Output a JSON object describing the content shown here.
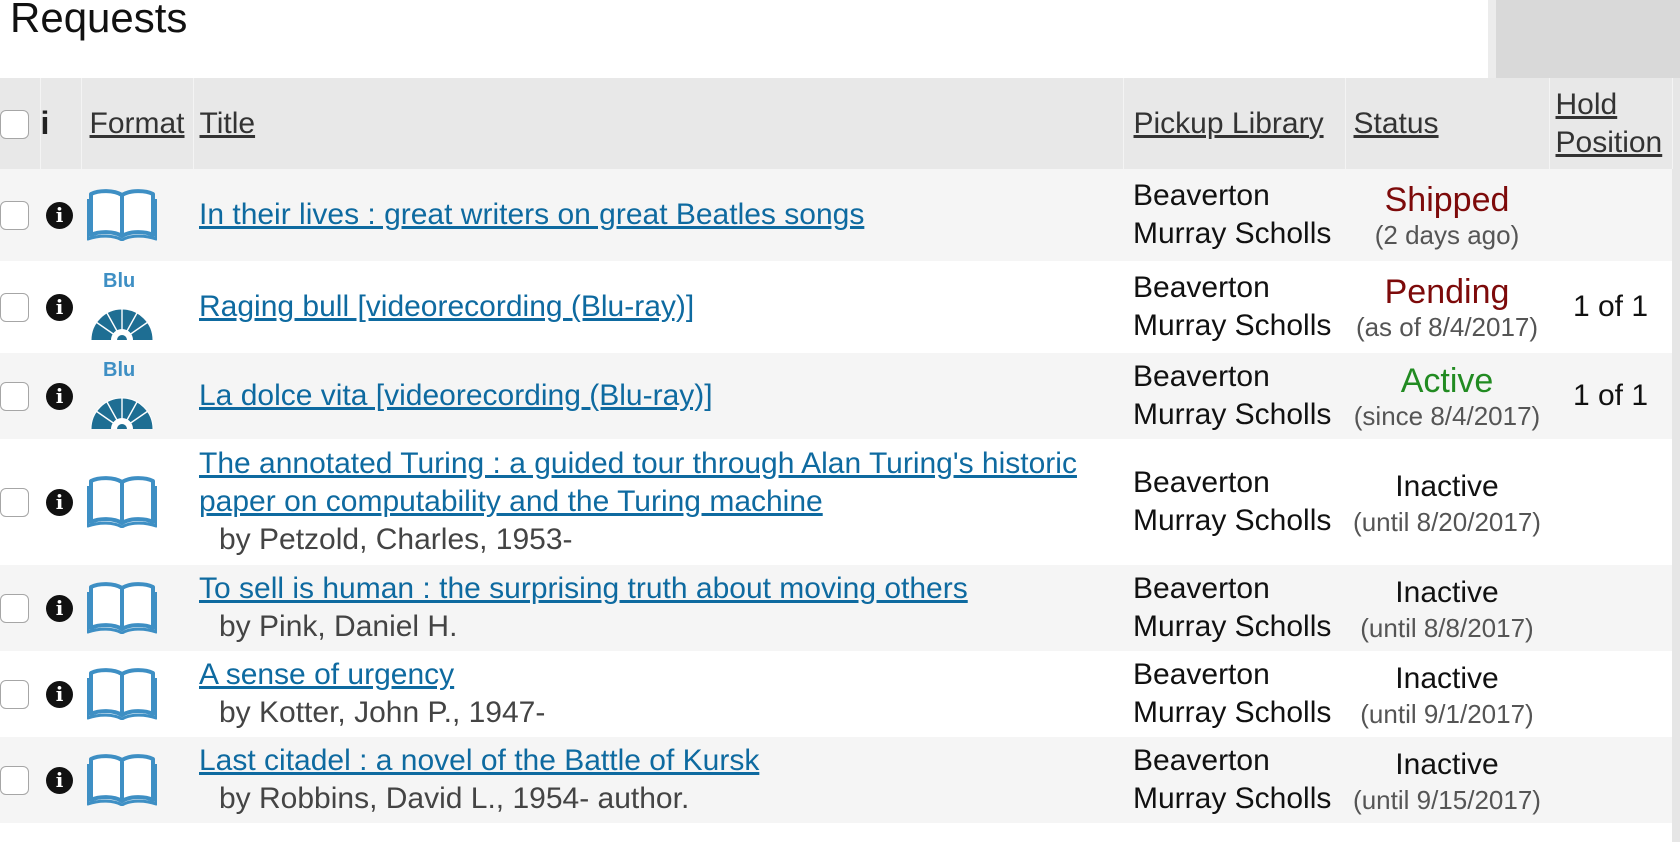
{
  "page": {
    "title": "Requests"
  },
  "table": {
    "headers": {
      "info": "i",
      "format": "Format",
      "title": "Title",
      "pickup": "Pickup Library",
      "status": "Status",
      "hold_line1": "Hold",
      "hold_line2": "Position"
    },
    "rows": [
      {
        "format": "book-icon",
        "title": "In their lives : great writers on great Beatles songs",
        "author": "",
        "pickup_line1": "Beaverton",
        "pickup_line2": "Murray Scholls",
        "status": "Shipped",
        "status_detail": "(2 days ago)",
        "hold": ""
      },
      {
        "format": "blu-ray-icon",
        "title": "Raging bull [videorecording (Blu-ray)]",
        "author": "",
        "pickup_line1": "Beaverton",
        "pickup_line2": "Murray Scholls",
        "status": "Pending",
        "status_detail": "(as of 8/4/2017)",
        "hold": "1 of 1"
      },
      {
        "format": "blu-ray-icon",
        "title": "La dolce vita [videorecording (Blu-ray)]",
        "author": "",
        "pickup_line1": "Beaverton",
        "pickup_line2": "Murray Scholls",
        "status": "Active",
        "status_detail": "(since 8/4/2017)",
        "hold": "1 of 1"
      },
      {
        "format": "book-icon",
        "title_line1": "The annotated Turing : a guided tour through Alan Turing's historic",
        "title_line2": "paper on computability and the Turing machine",
        "author": "by Petzold, Charles, 1953-",
        "pickup_line1": "Beaverton",
        "pickup_line2": "Murray Scholls",
        "status": "Inactive",
        "status_detail": "(until 8/20/2017)",
        "hold": ""
      },
      {
        "format": "book-icon",
        "title": "To sell is human : the surprising truth about moving others",
        "author": "by Pink, Daniel H.",
        "pickup_line1": "Beaverton",
        "pickup_line2": "Murray Scholls",
        "status": "Inactive",
        "status_detail": "(until 8/8/2017)",
        "hold": ""
      },
      {
        "format": "book-icon",
        "title": "A sense of urgency",
        "author": "by Kotter, John P., 1947-",
        "pickup_line1": "Beaverton",
        "pickup_line2": "Murray Scholls",
        "status": "Inactive",
        "status_detail": "(until 9/1/2017)",
        "hold": ""
      },
      {
        "format": "book-icon",
        "title": "Last citadel : a novel of the Battle of Kursk",
        "author": "by Robbins, David L., 1954- author.",
        "pickup_line1": "Beaverton",
        "pickup_line2": "Murray Scholls",
        "status": "Inactive",
        "status_detail": "(until 9/15/2017)",
        "hold": ""
      }
    ]
  },
  "colors": {
    "link": "#0e6aa0",
    "shipped_pending": "#7d0a0a",
    "active": "#228b22",
    "header_bg": "#e8e8e8",
    "row_alt_bg": "#f5f5f5",
    "book_icon": "#3e8fc4"
  },
  "icons": {
    "blu_label": "Blu"
  }
}
